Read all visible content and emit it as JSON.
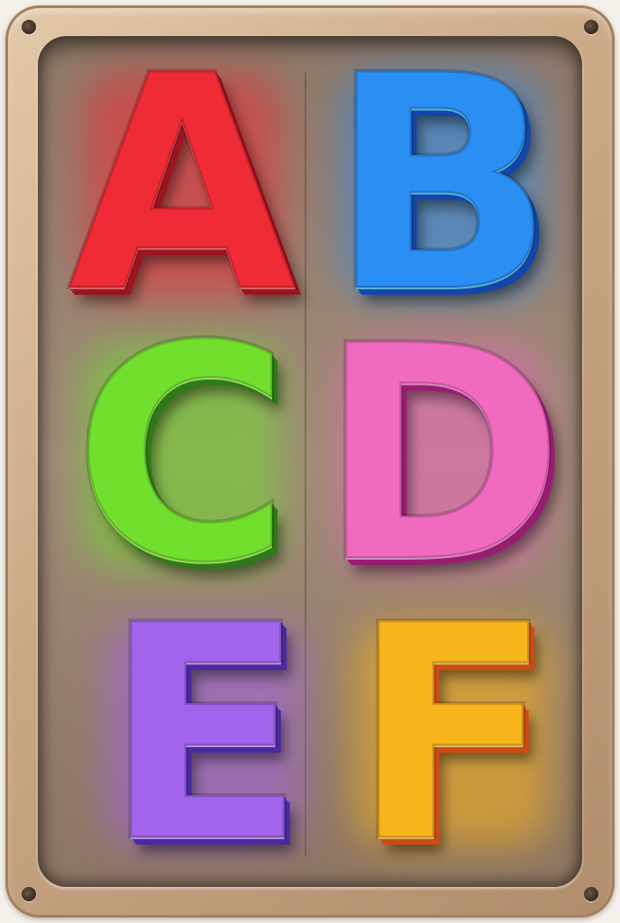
{
  "letters": [
    {
      "char": "A",
      "color": "#ef2b36",
      "shadow": "#9c1420",
      "highlight": "#ff7b7b"
    },
    {
      "char": "B",
      "color": "#2a8ef2",
      "shadow": "#1246a8",
      "highlight": "#6fd6ff"
    },
    {
      "char": "C",
      "color": "#72de2e",
      "shadow": "#2f7a18",
      "highlight": "#c3ff7a"
    },
    {
      "char": "D",
      "color": "#f06ac0",
      "shadow": "#9a1c72",
      "highlight": "#ffa9e2"
    },
    {
      "char": "E",
      "color": "#a264ea",
      "shadow": "#4a2aa0",
      "highlight": "#d7b1ff"
    },
    {
      "char": "F",
      "color": "#f9b51c",
      "shadow": "#d04a12",
      "highlight": "#ffe07a"
    }
  ],
  "icons": [
    "screw-icon"
  ]
}
